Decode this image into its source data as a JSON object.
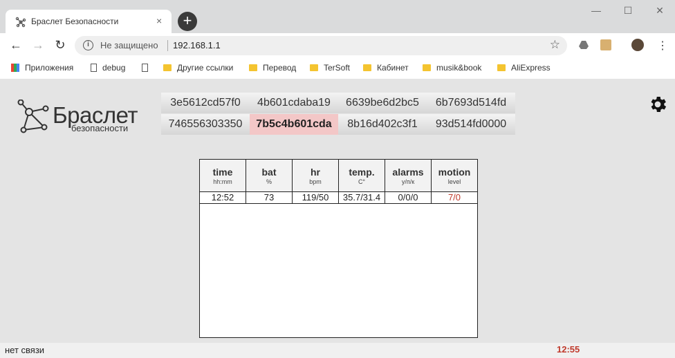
{
  "browser": {
    "tab_title": "Браслет Безопасности",
    "tab_close": "×",
    "new_tab": "+",
    "window_controls": {
      "minimize": "—",
      "maximize": "☐",
      "close": "✕"
    },
    "security_label": "Не защищено",
    "url": "192.168.1.1",
    "bookmarks": [
      {
        "label": "Приложения",
        "icon": "apps-icon"
      },
      {
        "label": "debug",
        "icon": "page-icon"
      },
      {
        "label": "",
        "icon": "page-icon"
      },
      {
        "label": "Другие ссылки",
        "icon": "folder-icon"
      },
      {
        "label": "Перевод",
        "icon": "folder-icon"
      },
      {
        "label": "TerSoft",
        "icon": "folder-icon"
      },
      {
        "label": "Кабинет",
        "icon": "folder-icon"
      },
      {
        "label": "musik&book",
        "icon": "folder-icon"
      },
      {
        "label": "AliExpress",
        "icon": "folder-icon"
      }
    ]
  },
  "logo": {
    "title": "Браслет",
    "subtitle": "безопасности"
  },
  "devices": [
    {
      "id": "3e5612cd57f0",
      "active": false
    },
    {
      "id": "4b601cdaba19",
      "active": false
    },
    {
      "id": "6639be6d2bc5",
      "active": false
    },
    {
      "id": "6b7693d514fd",
      "active": false
    },
    {
      "id": "746556303350",
      "active": false
    },
    {
      "id": "7b5c4b601cda",
      "active": true
    },
    {
      "id": "8b16d402c3f1",
      "active": false
    },
    {
      "id": "93d514fd0000",
      "active": false
    }
  ],
  "table": {
    "columns": [
      {
        "label": "time",
        "unit": "hh:mm"
      },
      {
        "label": "bat",
        "unit": "%"
      },
      {
        "label": "hr",
        "unit": "bpm"
      },
      {
        "label": "temp.",
        "unit": "C°"
      },
      {
        "label": "alarms",
        "unit": "у/п/к"
      },
      {
        "label": "motion",
        "unit": "level"
      }
    ],
    "rows": [
      [
        "12:52",
        "73",
        "119/50",
        "35.7/31.4",
        "0/0/0",
        "7/0"
      ]
    ]
  },
  "status": {
    "text": "нет связи",
    "time": "12:55"
  },
  "colors": {
    "accent_red": "#c0392b",
    "active_device_bg": "#f3c7c7"
  }
}
